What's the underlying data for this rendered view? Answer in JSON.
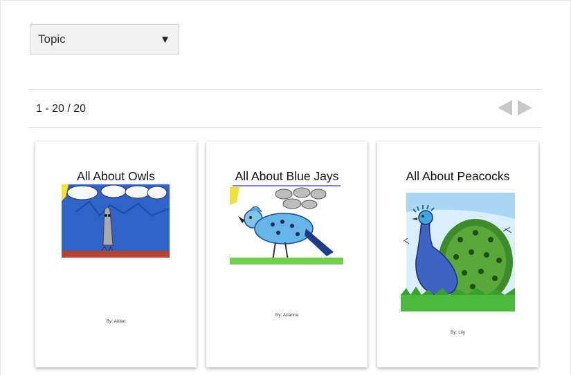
{
  "filter": {
    "topic_label": "Topic",
    "caret": "▼"
  },
  "pager": {
    "range_text": "1 - 20 / 20"
  },
  "books": [
    {
      "title": "All About Owls",
      "author": "By: Aidan",
      "art": "owl-drawing"
    },
    {
      "title": "All About Blue Jays",
      "author": "By: Arianna",
      "art": "blue-jay-drawing"
    },
    {
      "title": "All About Peacocks",
      "author": "By: Lily",
      "art": "peacock-drawing"
    }
  ],
  "colors": {
    "arrow": "#c8c8c8",
    "select_bg": "#f1f1f1"
  }
}
